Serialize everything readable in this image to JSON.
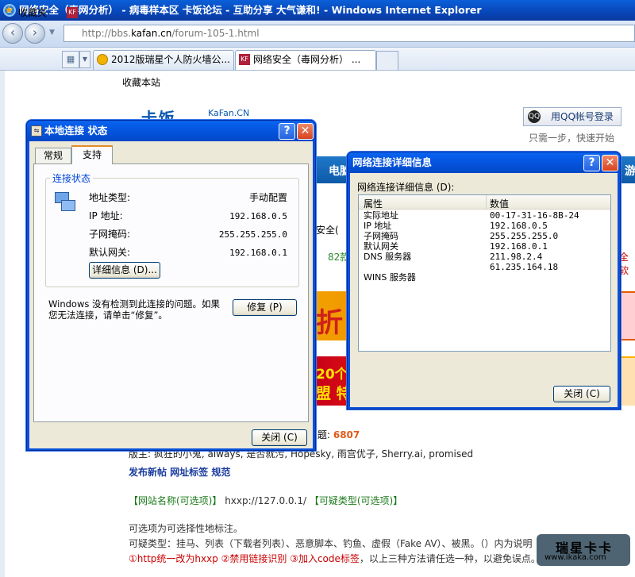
{
  "browser": {
    "title": "网络安全（毒网分析） - 病毒样本区 卡饭论坛 - 互助分享 大气谦和! - Windows Internet Explorer",
    "address_grey": "http://bbs.",
    "address_domain": "kafan.cn",
    "address_path": "/forum-105-1.html",
    "favorites_label": "收藏夹",
    "tabs": [
      {
        "label": "2012版瑞星个人防火墙公...",
        "active": false
      },
      {
        "label": "网络安全（毒网分析） ...",
        "active": true
      }
    ]
  },
  "page": {
    "bookmark_link": "收藏本站",
    "logo_text": "卡饭",
    "logo_sub": "KaFan.CN",
    "qq_login": "用QQ帐号登录",
    "qq_sub": "只需一步，快速开始",
    "nav_text_left": "电脑",
    "nav_text_right": "游",
    "snippet_security": "安全(",
    "snippet_count": "82款",
    "snippet_right": "全软",
    "banner1_text": "折",
    "banner2_line1": "20个",
    "banner2_line2": "盟  特",
    "stat_label": "题: ",
    "stat_value": "6807",
    "moderators": "版主: 疯狂的小鬼, always, 是否就污, Hopesky, 雨宫优子, Sherry.ai, promised",
    "actions": "发布新帖  网址标签  规范",
    "rule_line1_a": "【网站名称(可选项)】",
    "rule_line1_url": " hxxp://127.0.0.1/ ",
    "rule_line1_b": "【可疑类型(可选项)】",
    "rule_line2": "可选项为可选择性地标注。",
    "rule_line3": "可疑类型：挂马、列表（下载者列表）、恶意脚本、钓鱼、虚假（Fake AV）、被黑。（）内为说明",
    "rule_line4_red": "①http统一改为hxxp ②禁用链接识别 ③加入code标签",
    "rule_line4_rest": "，以上三种方法请任选一种，以避免误点。",
    "watermark_1": "瑞星卡卡",
    "watermark_2": "www.ikaka.com"
  },
  "status_dialog": {
    "title": "本地连接 状态",
    "tabs": [
      "常规",
      "支持"
    ],
    "group_label": "连接状态",
    "rows": [
      {
        "label": "地址类型:",
        "value": "手动配置"
      },
      {
        "label": "IP 地址:",
        "value": "192.168.0.5"
      },
      {
        "label": "子网掩码:",
        "value": "255.255.255.0"
      },
      {
        "label": "默认网关:",
        "value": "192.168.0.1"
      }
    ],
    "details_button": "详细信息 (D)...",
    "message": "Windows 没有检测到此连接的问题。如果您无法连接，请单击“修复”。",
    "repair_button": "修复 (P)",
    "close_button": "关闭 (C)"
  },
  "details_dialog": {
    "title": "网络连接详细信息",
    "list_label": "网络连接详细信息 (D):",
    "col_property": "属性",
    "col_value": "数值",
    "rows": [
      {
        "property": "实际地址",
        "value": "00-17-31-16-8B-24"
      },
      {
        "property": "IP 地址",
        "value": "192.168.0.5"
      },
      {
        "property": "子网掩码",
        "value": "255.255.255.0"
      },
      {
        "property": "默认网关",
        "value": "192.168.0.1"
      },
      {
        "property": "DNS 服务器",
        "value": "211.98.2.4"
      },
      {
        "property": "",
        "value": "61.235.164.18"
      },
      {
        "property": "WINS 服务器",
        "value": ""
      }
    ],
    "close_button": "关闭 (C)"
  }
}
